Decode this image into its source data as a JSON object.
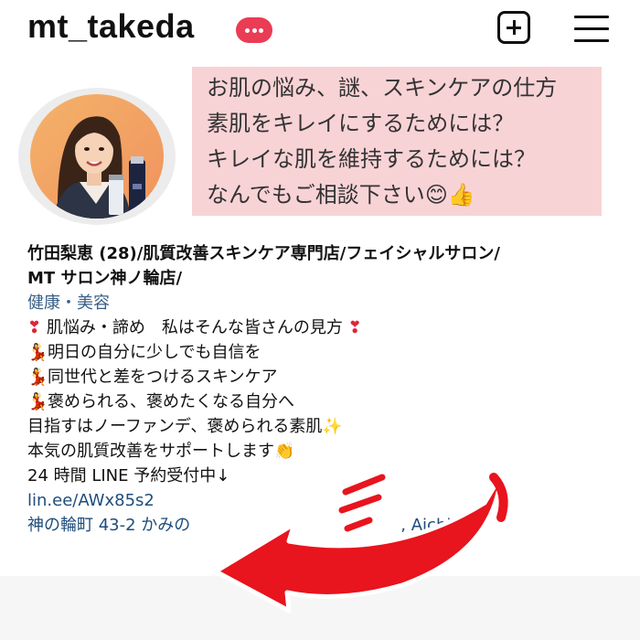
{
  "profile": {
    "username": "mt_takeda",
    "badge_icon": "more-dots-icon",
    "badge_color": "#ea3c54"
  },
  "header": {
    "add_icon": "plus-square-icon",
    "menu_icon": "hamburger-menu-icon"
  },
  "speech": {
    "lines": [
      "お肌の悩み、謎、スキンケアの仕方",
      "素肌をキレイにするためには？",
      "キレイな肌を維持するためには？",
      "なんでもご相談下さい"
    ],
    "emojis": [
      "😊",
      "👍"
    ],
    "background_color": "#f8d3d6"
  },
  "bio": {
    "name_line_1": "竹田梨恵 (28)/肌質改善スキンケア専門店/フェイシャルサロン/",
    "name_line_2": "MT サロン神ノ輪店/",
    "category": "健康・美容",
    "line_1": "肌悩み・諦め　私はそんな皆さんの見方",
    "line_2": "明日の自分に少しでも自信を",
    "line_3": "同世代と差をつけるスキンケア",
    "line_4": "褒められる、褒めたくなる自分へ",
    "line_5": "目指すはノーファンデ、褒められる素肌",
    "line_6": "本気の肌質改善をサポートします",
    "line_7": "24 時間 LINE 予約受付中↓",
    "link": "lin.ee/AWx85s2",
    "address_visible": "神の輪町 43-2 かみの",
    "address_tail": ", Aichi",
    "heart_icon": "❣",
    "dancer_icon": "💃",
    "sparkle_icon": "✨",
    "clap_icon": "👏"
  },
  "annotation": {
    "arrow_color": "#e8141e",
    "arrow_icon": "red-curved-arrow-icon"
  }
}
